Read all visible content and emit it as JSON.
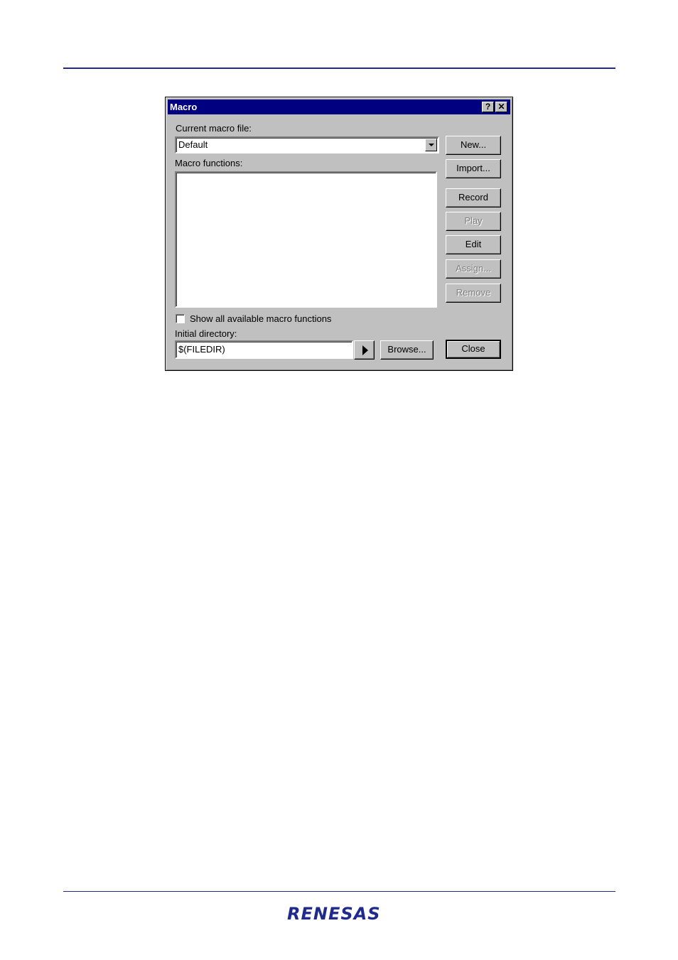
{
  "dialog": {
    "title": "Macro",
    "help_glyph": "?",
    "close_glyph": "✕",
    "current_file_label": "Current macro file:",
    "current_file_value": "Default",
    "functions_label": "Macro functions:",
    "show_all_label": "Show all available macro functions",
    "show_all_checked": false,
    "initial_dir_label": "Initial directory:",
    "initial_dir_value": "$(FILEDIR)",
    "buttons": {
      "new": "New...",
      "import": "Import...",
      "record": "Record",
      "play": "Play",
      "edit": "Edit",
      "assign": "Assign...",
      "remove": "Remove",
      "browse": "Browse...",
      "close": "Close"
    },
    "icons": {
      "dropdown": "chevron-down-icon",
      "play_dir": "play-arrow-icon"
    }
  },
  "footer": {
    "logo": "RENESAS"
  },
  "colors": {
    "accent_rule": "#1f2a8c",
    "titlebar": "#000080",
    "dialog_face": "#c0c0c0"
  }
}
